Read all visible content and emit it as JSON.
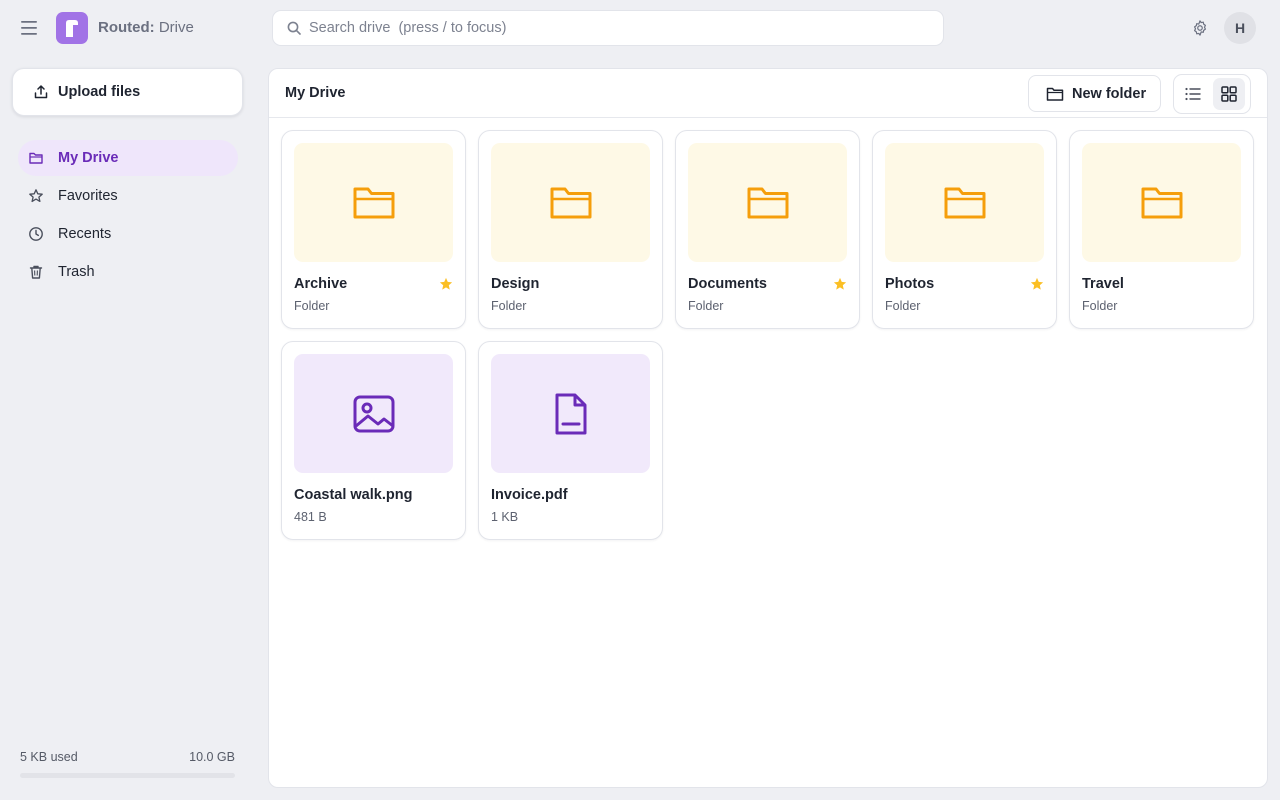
{
  "app": {
    "brand": "Routed:",
    "name": "Drive",
    "logo_letter": "r",
    "accent": "#a173e6"
  },
  "search": {
    "placeholder": "Search drive  (press / to focus)",
    "icon": "search-icon"
  },
  "header": {
    "settings_icon": "gear-icon",
    "avatar_initial": "H"
  },
  "sidebar": {
    "upload_label": "Upload files",
    "items": [
      {
        "label": "My Drive",
        "icon": "folder-icon",
        "active": true
      },
      {
        "label": "Favorites",
        "icon": "star-icon",
        "active": false
      },
      {
        "label": "Recents",
        "icon": "clock-icon",
        "active": false
      },
      {
        "label": "Trash",
        "icon": "trash-icon",
        "active": false
      }
    ],
    "storage": {
      "used": "5 KB used",
      "total": "10.0 GB",
      "fraction_used": 5e-07
    }
  },
  "main": {
    "title": "My Drive",
    "new_folder_label": "New folder",
    "view_mode": "grid",
    "items": [
      {
        "name": "Archive",
        "meta": "Folder",
        "kind": "folder",
        "starred": true
      },
      {
        "name": "Design",
        "meta": "Folder",
        "kind": "folder",
        "starred": false
      },
      {
        "name": "Documents",
        "meta": "Folder",
        "kind": "folder",
        "starred": true
      },
      {
        "name": "Photos",
        "meta": "Folder",
        "kind": "folder",
        "starred": true
      },
      {
        "name": "Travel",
        "meta": "Folder",
        "kind": "folder",
        "starred": false
      },
      {
        "name": "Coastal walk.png",
        "meta": "481 B",
        "kind": "image",
        "starred": false
      },
      {
        "name": "Invoice.pdf",
        "meta": "1 KB",
        "kind": "document",
        "starred": false
      }
    ]
  },
  "colors": {
    "folder_icon": "#f59e0b",
    "file_icon": "#6a2bb8",
    "star": "#fbbf24",
    "active_nav_bg": "#efe6fb"
  }
}
